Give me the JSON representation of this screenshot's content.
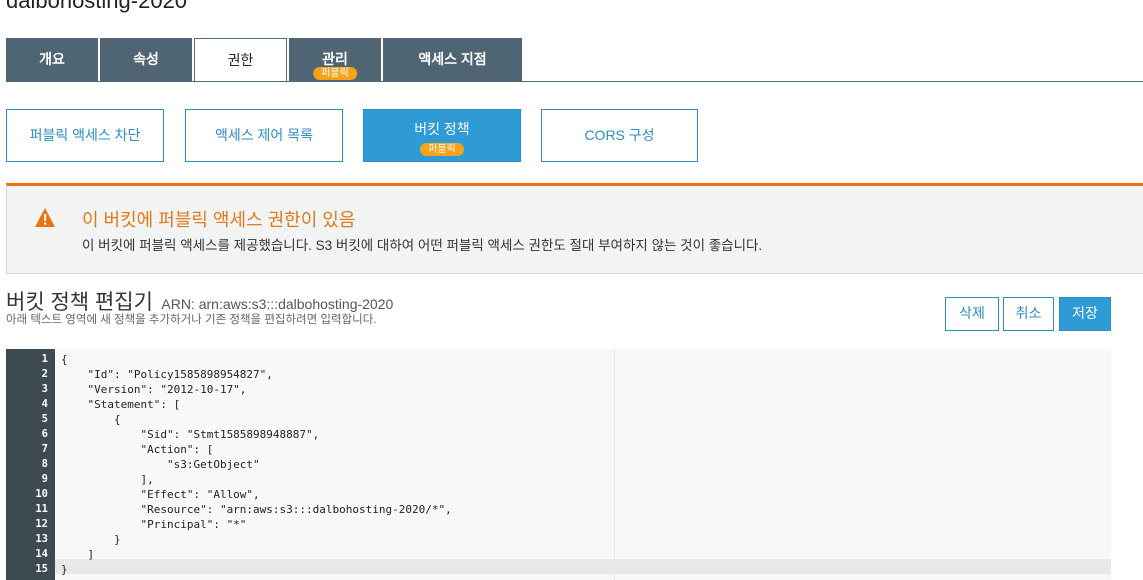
{
  "bucket": {
    "name": "dalbohosting-2020"
  },
  "main_tabs": [
    {
      "label": "개요"
    },
    {
      "label": "속성"
    },
    {
      "label": "권한"
    },
    {
      "label": "관리",
      "badge": "퍼블릭"
    },
    {
      "label": "액세스 지점"
    }
  ],
  "sub_tabs": [
    {
      "label": "퍼블릭 액세스 차단"
    },
    {
      "label": "액세스 제어 목록"
    },
    {
      "label": "버킷 정책",
      "badge": "퍼블릭"
    },
    {
      "label": "CORS 구성"
    }
  ],
  "alert": {
    "title": "이 버킷에 퍼블릭 액세스 권한이 있음",
    "text": "이 버킷에 퍼블릭 액세스를 제공했습니다. S3 버킷에 대하여 어떤 퍼블릭 액세스 권한도 절대 부여하지 않는 것이 좋습니다.",
    "color": "#ec7211"
  },
  "editor": {
    "title": "버킷 정책 편집기",
    "arn": "ARN: arn:aws:s3:::dalbohosting-2020",
    "subtitle": "아래 텍스트 영역에 새 정책을 추가하거나 기존 정책을 편집하려면 입력합니다.",
    "buttons": {
      "delete": "삭제",
      "cancel": "취소",
      "save": "저장"
    },
    "line_numbers": [
      "1",
      "2",
      "3",
      "4",
      "5",
      "6",
      "7",
      "8",
      "9",
      "10",
      "11",
      "12",
      "13",
      "14",
      "15"
    ],
    "code_lines": [
      "{",
      "    \"Id\": \"Policy1585898954827\",",
      "    \"Version\": \"2012-10-17\",",
      "    \"Statement\": [",
      "        {",
      "            \"Sid\": \"Stmt1585898948887\",",
      "            \"Action\": [",
      "                \"s3:GetObject\"",
      "            ],",
      "            \"Effect\": \"Allow\",",
      "            \"Resource\": \"arn:aws:s3:::dalbohosting-2020/*\",",
      "            \"Principal\": \"*\"",
      "        }",
      "    ]",
      "}"
    ]
  },
  "colors": {
    "accent": "#2e9ad6",
    "tab_dark": "#4f6574",
    "warning": "#ec7211",
    "badge": "#f7a21b"
  }
}
